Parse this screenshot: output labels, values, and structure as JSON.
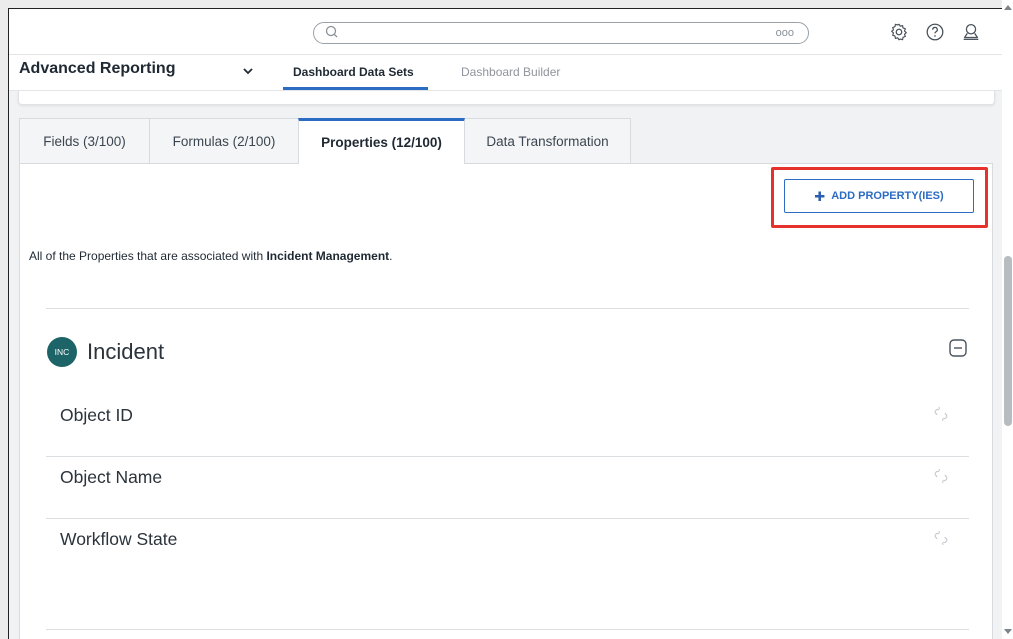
{
  "topbar": {
    "search_placeholder": "",
    "search_more": "ooo",
    "icons": [
      "search-icon",
      "settings-icon",
      "help-icon",
      "user-icon"
    ]
  },
  "nav": {
    "app_title": "Advanced Reporting",
    "tabs": [
      {
        "label": "Dashboard Data Sets",
        "active": true
      },
      {
        "label": "Dashboard Builder",
        "active": false
      }
    ]
  },
  "tabs": [
    {
      "label": "Fields (3/100)",
      "active": false
    },
    {
      "label": "Formulas (2/100)",
      "active": false
    },
    {
      "label": "Properties (12/100)",
      "active": true
    },
    {
      "label": "Data Transformation",
      "active": false
    }
  ],
  "panel": {
    "add_button_label": "ADD PROPERTY(IES)",
    "description_prefix": "All of the Properties that are associated with ",
    "description_bold": "Incident Management",
    "description_suffix": "."
  },
  "object": {
    "badge": "INC",
    "title": "Incident",
    "properties": [
      {
        "label": "Object ID"
      },
      {
        "label": "Object Name"
      },
      {
        "label": "Workflow State"
      }
    ]
  },
  "colors": {
    "accent": "#2b6cc4",
    "highlight": "#e5322d",
    "badge": "#1d6468"
  }
}
